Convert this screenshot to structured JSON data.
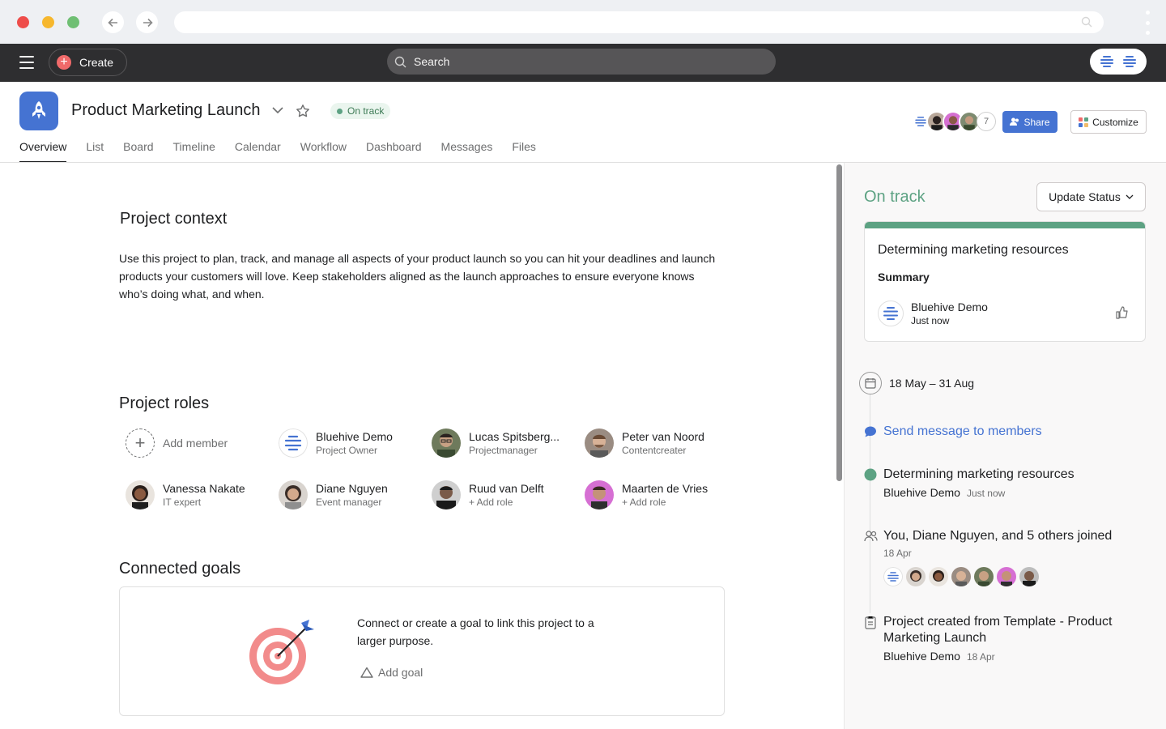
{
  "topbar": {
    "create_label": "Create",
    "search_placeholder": "Search"
  },
  "project": {
    "title": "Product Marketing Launch",
    "status_pill": "On track",
    "member_count": "7",
    "share_label": "Share",
    "customize_label": "Customize"
  },
  "tabs": [
    "Overview",
    "List",
    "Board",
    "Timeline",
    "Calendar",
    "Workflow",
    "Dashboard",
    "Messages",
    "Files"
  ],
  "context": {
    "heading": "Project context",
    "text": "Use this project to plan, track, and manage all aspects of your product launch so you can hit your deadlines and launch products your customers will love. Keep stakeholders aligned as the launch approaches to ensure everyone knows who’s doing what, and when."
  },
  "roles": {
    "heading": "Project roles",
    "add_member": "Add member",
    "members": [
      {
        "name": "Bluehive Demo",
        "role": "Project Owner"
      },
      {
        "name": "Lucas Spitsberg...",
        "role": "Projectmanager"
      },
      {
        "name": "Peter van Noord",
        "role": "Contentcreater"
      },
      {
        "name": "Vanessa Nakate",
        "role": "IT expert"
      },
      {
        "name": "Diane Nguyen",
        "role": "Event manager"
      },
      {
        "name": "Ruud van Delft",
        "role": "+ Add role"
      },
      {
        "name": "Maarten de Vries",
        "role": "+ Add role"
      }
    ]
  },
  "goals": {
    "heading": "Connected goals",
    "text": "Connect or create a goal to link this project to a larger purpose.",
    "add_goal": "Add goal"
  },
  "panel": {
    "status": "On track",
    "update_status": "Update Status",
    "card": {
      "title": "Determining marketing resources",
      "summary": "Summary",
      "author": "Bluehive Demo",
      "time": "Just now"
    },
    "date_range": "18 May – 31 Aug",
    "send_message": "Send message to members",
    "events": [
      {
        "title": "Determining marketing resources",
        "who": "Bluehive Demo",
        "when": "Just now"
      },
      {
        "title": "You, Diane Nguyen, and 5 others joined",
        "when": "18 Apr"
      },
      {
        "title": "Project created from Template - Product Marketing Launch",
        "who": "Bluehive Demo",
        "when": "18 Apr"
      }
    ]
  },
  "colors": {
    "accent_blue": "#4573d2",
    "on_track_green": "#5da283",
    "create_red": "#f06a6a",
    "topbar_dark": "#2e2e30"
  }
}
